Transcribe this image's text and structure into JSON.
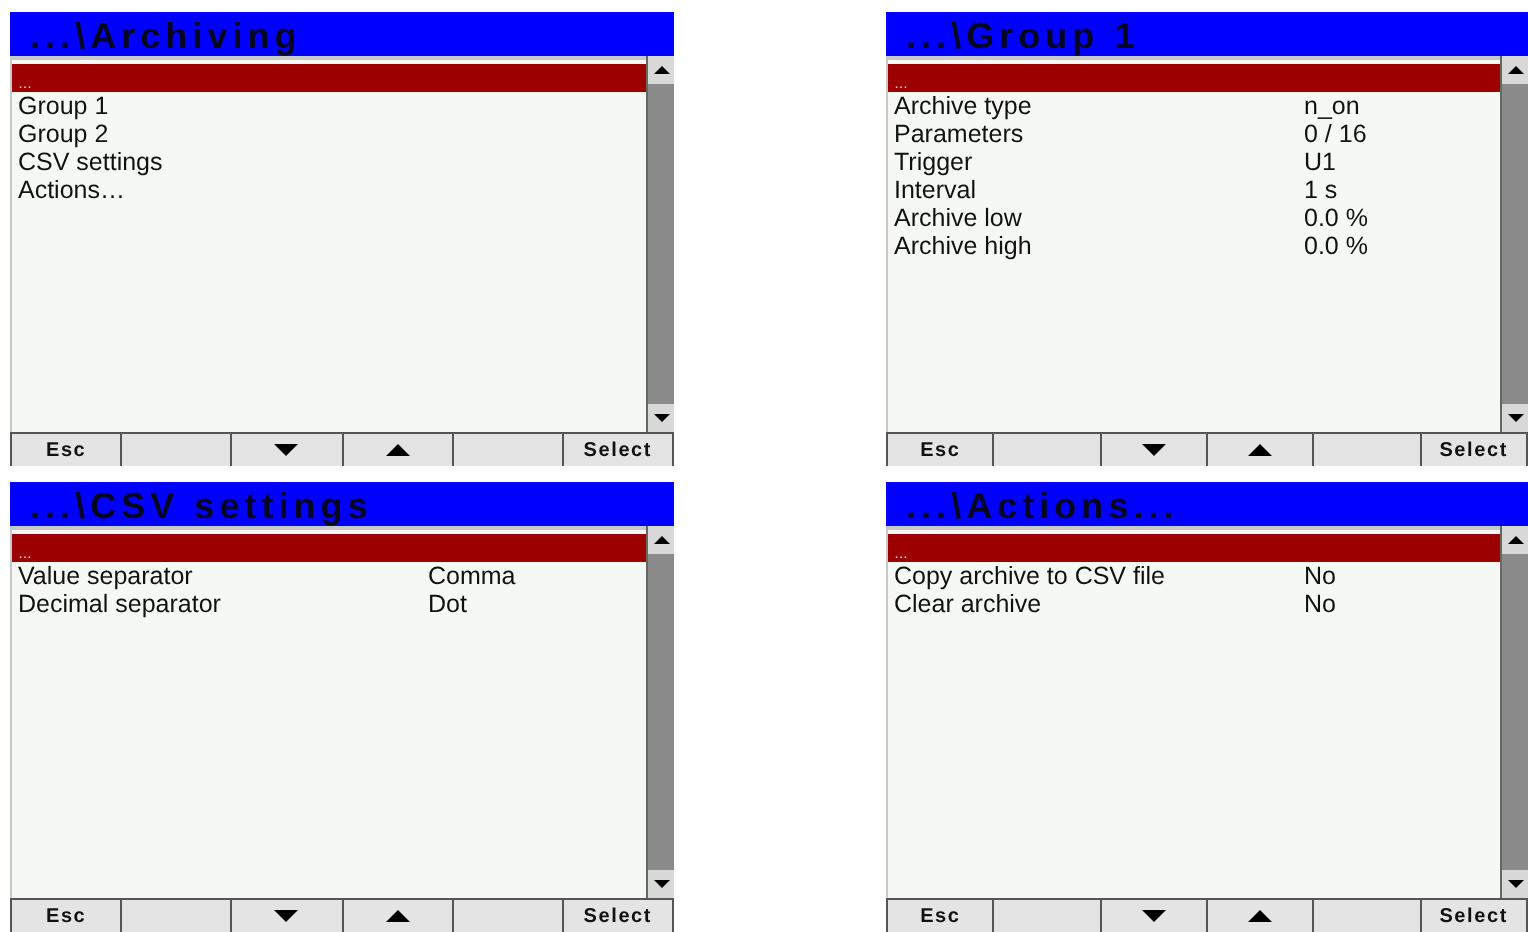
{
  "screens": [
    {
      "title": "...\\Archiving",
      "items": [
        {
          "label": "…",
          "selected": true
        },
        {
          "label": "Group 1",
          "selected": false
        },
        {
          "label": "Group 2",
          "selected": false
        },
        {
          "label": "CSV settings",
          "selected": false
        },
        {
          "label": "Actions…",
          "selected": false
        }
      ],
      "softkeys": [
        {
          "kind": "text",
          "label": "Esc"
        },
        {
          "kind": "blank"
        },
        {
          "kind": "down"
        },
        {
          "kind": "up"
        },
        {
          "kind": "blank"
        },
        {
          "kind": "text",
          "label": "Select"
        }
      ]
    },
    {
      "title": "...\\Group 1",
      "items": [
        {
          "label": "…",
          "selected": true
        },
        {
          "label": "Archive type",
          "value": "n_on",
          "selected": false
        },
        {
          "label": "Parameters",
          "value": "0 / 16",
          "selected": false
        },
        {
          "label": "Trigger",
          "value": "U1",
          "selected": false
        },
        {
          "label": "Interval",
          "value": "1 s",
          "selected": false
        },
        {
          "label": "Archive low",
          "value": "0.0 %",
          "selected": false
        },
        {
          "label": "Archive high",
          "value": "0.0 %",
          "selected": false
        }
      ],
      "softkeys": [
        {
          "kind": "text",
          "label": "Esc"
        },
        {
          "kind": "blank"
        },
        {
          "kind": "down"
        },
        {
          "kind": "up"
        },
        {
          "kind": "blank"
        },
        {
          "kind": "text",
          "label": "Select"
        }
      ]
    },
    {
      "title": "...\\CSV settings",
      "items": [
        {
          "label": "…",
          "selected": true
        },
        {
          "label": "Value separator",
          "value": "Comma",
          "selected": false
        },
        {
          "label": "Decimal separator",
          "value": "Dot",
          "selected": false
        }
      ],
      "softkeys": [
        {
          "kind": "text",
          "label": "Esc"
        },
        {
          "kind": "blank"
        },
        {
          "kind": "down"
        },
        {
          "kind": "up"
        },
        {
          "kind": "blank"
        },
        {
          "kind": "text",
          "label": "Select"
        }
      ]
    },
    {
      "title": "...\\Actions...",
      "items": [
        {
          "label": "…",
          "selected": true
        },
        {
          "label": "Copy archive to CSV file",
          "value": "No",
          "selected": false
        },
        {
          "label": "Clear archive",
          "value": "No",
          "selected": false
        }
      ],
      "softkeys": [
        {
          "kind": "text",
          "label": "Esc"
        },
        {
          "kind": "blank"
        },
        {
          "kind": "down"
        },
        {
          "kind": "up"
        },
        {
          "kind": "blank"
        },
        {
          "kind": "text",
          "label": "Select"
        }
      ]
    }
  ]
}
